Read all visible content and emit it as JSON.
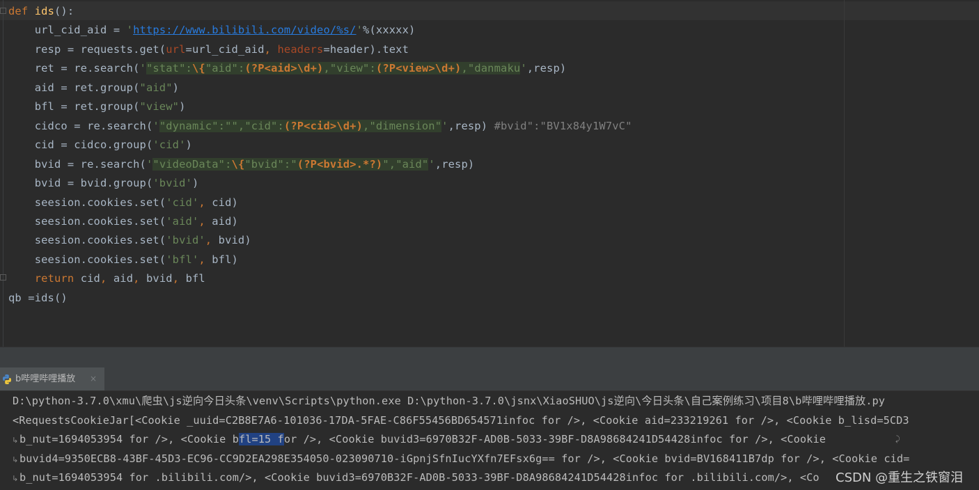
{
  "editor": {
    "lines": [
      {
        "parts": [
          {
            "t": "def ",
            "c": "kw"
          },
          {
            "t": "ids",
            "c": "fn"
          },
          {
            "t": "():"
          }
        ]
      },
      {
        "parts": [
          {
            "t": "    url_cid_aid = "
          },
          {
            "t": "'",
            "c": "str"
          },
          {
            "t": "https://www.bilibili.com/video/%s/",
            "c": "url"
          },
          {
            "t": "'",
            "c": "str"
          },
          {
            "t": "%(xxxxx)"
          }
        ]
      },
      {
        "parts": [
          {
            "t": "    resp = requests.get("
          },
          {
            "t": "url",
            "c": "prm"
          },
          {
            "t": "=url_cid_aid"
          },
          {
            "t": ", ",
            "c": "kw"
          },
          {
            "t": "headers",
            "c": "prm"
          },
          {
            "t": "=header).text"
          }
        ]
      },
      {
        "parts": [
          {
            "t": "    ret = re.search("
          },
          {
            "t": "'",
            "c": "str"
          },
          {
            "t": "\"stat\":",
            "c": "str rgx"
          },
          {
            "t": "\\{",
            "c": "rx rgx"
          },
          {
            "t": "\"aid\":",
            "c": "str rgx"
          },
          {
            "t": "(?P<aid>\\d+)",
            "c": "rx rgx"
          },
          {
            "t": ",\"view\":",
            "c": "str rgx"
          },
          {
            "t": "(?P<view>\\d+)",
            "c": "rx rgx"
          },
          {
            "t": ",\"danmaku",
            "c": "str rgx"
          },
          {
            "t": "'",
            "c": "str"
          },
          {
            "t": ",resp)"
          }
        ]
      },
      {
        "parts": [
          {
            "t": "    aid = ret.group("
          },
          {
            "t": "\"aid\"",
            "c": "str"
          },
          {
            "t": ")"
          }
        ]
      },
      {
        "parts": [
          {
            "t": "    bfl = ret.group("
          },
          {
            "t": "\"view\"",
            "c": "str"
          },
          {
            "t": ")"
          }
        ]
      },
      {
        "parts": [
          {
            "t": "    cidco = re.search("
          },
          {
            "t": "'",
            "c": "str"
          },
          {
            "t": "\"dynamic\":\"\",\"cid\":",
            "c": "str rgx"
          },
          {
            "t": "(?P<cid>\\d+)",
            "c": "rx rgx"
          },
          {
            "t": ",\"dimension\"",
            "c": "str rgx"
          },
          {
            "t": "'",
            "c": "str"
          },
          {
            "t": ",resp) "
          },
          {
            "t": "#bvid\":\"BV1x84y1W7vC\"",
            "c": "cm"
          }
        ]
      },
      {
        "parts": [
          {
            "t": "    cid = cidco.group("
          },
          {
            "t": "'cid'",
            "c": "str"
          },
          {
            "t": ")"
          }
        ]
      },
      {
        "parts": [
          {
            "t": "    bvid = re.search("
          },
          {
            "t": "'",
            "c": "str"
          },
          {
            "t": "\"videoData\":",
            "c": "str rgx"
          },
          {
            "t": "\\{",
            "c": "rx rgx"
          },
          {
            "t": "\"bvid\":\"",
            "c": "str rgx"
          },
          {
            "t": "(?P<bvid>.*?)",
            "c": "rx rgx"
          },
          {
            "t": "\",\"aid\"",
            "c": "str rgx"
          },
          {
            "t": "'",
            "c": "str"
          },
          {
            "t": ",resp)"
          }
        ]
      },
      {
        "parts": [
          {
            "t": "    bvid = bvid.group("
          },
          {
            "t": "'bvid'",
            "c": "str"
          },
          {
            "t": ")"
          }
        ]
      },
      {
        "parts": [
          {
            "t": "    seesion.cookies.set("
          },
          {
            "t": "'cid'",
            "c": "str"
          },
          {
            "t": ", ",
            "c": "kw"
          },
          {
            "t": "cid)"
          }
        ]
      },
      {
        "parts": [
          {
            "t": "    seesion.cookies.set("
          },
          {
            "t": "'aid'",
            "c": "str"
          },
          {
            "t": ", ",
            "c": "kw"
          },
          {
            "t": "aid)"
          }
        ]
      },
      {
        "parts": [
          {
            "t": "    seesion.cookies.set("
          },
          {
            "t": "'bvid'",
            "c": "str"
          },
          {
            "t": ", ",
            "c": "kw"
          },
          {
            "t": "bvid)"
          }
        ]
      },
      {
        "parts": [
          {
            "t": "    seesion.cookies.set("
          },
          {
            "t": "'bfl'",
            "c": "str"
          },
          {
            "t": ", ",
            "c": "kw"
          },
          {
            "t": "bfl)"
          }
        ]
      },
      {
        "parts": [
          {
            "t": "    "
          },
          {
            "t": "return ",
            "c": "kw"
          },
          {
            "t": "cid"
          },
          {
            "t": ", ",
            "c": "kw"
          },
          {
            "t": "aid"
          },
          {
            "t": ", ",
            "c": "kw"
          },
          {
            "t": "bvid"
          },
          {
            "t": ", ",
            "c": "kw"
          },
          {
            "t": "bfl"
          }
        ]
      },
      {
        "parts": [
          {
            "t": "qb =ids()"
          }
        ]
      }
    ]
  },
  "run_panel": {
    "tab_label": "b哔哩哔哩播放",
    "close_glyph": "×",
    "python_icon": "python-icon"
  },
  "console": {
    "wrap_glyph": "↳",
    "wrap_end_glyph": "⤸",
    "lines": [
      {
        "wrapped": false,
        "wrap_end": false,
        "parts": [
          {
            "t": "D:\\python-3.7.0\\xmu\\爬虫\\js逆向今日头条\\venv\\Scripts\\python.exe D:\\python-3.7.0\\jsnx\\XiaoSHUO\\js逆向\\今日头条\\自己案例练习\\项目8\\b哔哩哔哩播放.py"
          }
        ]
      },
      {
        "wrapped": false,
        "wrap_end": false,
        "parts": [
          {
            "t": "<RequestsCookieJar[<Cookie _uuid=C2B8E7A6-101036-17DA-5FAE-C86F55456BD654571infoc for />, <Cookie aid=233219261 for />, <Cookie b_lisd=5CD3"
          }
        ]
      },
      {
        "wrapped": true,
        "wrap_end": true,
        "parts": [
          {
            "t": "b_nut=1694053954 for />, <Cookie b"
          },
          {
            "t": "fl=15 f",
            "sel": true
          },
          {
            "t": "or />, <Cookie buvid3=6970B32F-AD0B-5033-39BF-D8A98684241D54428infoc for />, <Cookie"
          }
        ]
      },
      {
        "wrapped": true,
        "wrap_end": false,
        "parts": [
          {
            "t": "buvid4=9350ECB8-43BF-45D3-EC96-CC9D2EA298E354050-023090710-iGpnjSfnIucYXfn7EFsx6g== for />, <Cookie bvid=BV168411B7dp for />, <Cookie cid="
          }
        ]
      },
      {
        "wrapped": true,
        "wrap_end": false,
        "parts": [
          {
            "t": "b_nut=1694053954 for .bilibili.com/>, <Cookie buvid3=6970B32F-AD0B-5033-39BF-D8A98684241D54428infoc for .bilibili.com/>, <Co"
          }
        ]
      }
    ]
  },
  "watermark": "CSDN @重生之铁窗泪",
  "colors": {
    "editor_bg": "#2b2b2b",
    "keyword": "#cc7832",
    "function": "#ffc66d",
    "string": "#6a8759",
    "url": "#287bde",
    "param": "#aa4926",
    "default_text": "#a9b7c6",
    "selection": "#214283"
  }
}
